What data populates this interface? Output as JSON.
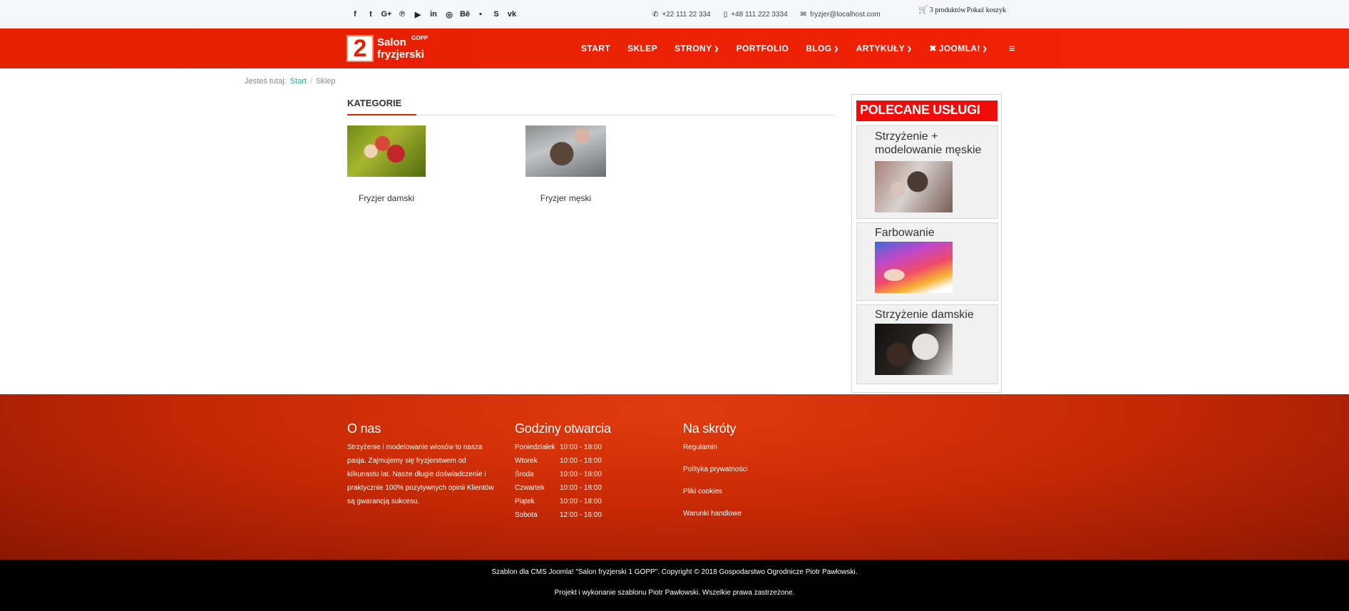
{
  "topbar": {
    "social": [
      {
        "icon": "facebook-icon",
        "glyph": "f"
      },
      {
        "icon": "twitter-icon",
        "glyph": "t"
      },
      {
        "icon": "google-plus-icon",
        "glyph": "G+"
      },
      {
        "icon": "pinterest-icon",
        "glyph": "℗"
      },
      {
        "icon": "youtube-icon",
        "glyph": "▶"
      },
      {
        "icon": "linkedin-icon",
        "glyph": "in"
      },
      {
        "icon": "dribbble-icon",
        "glyph": "◎"
      },
      {
        "icon": "behance-icon",
        "glyph": "Bē"
      },
      {
        "icon": "flickr-icon",
        "glyph": "▪"
      },
      {
        "icon": "skype-icon",
        "glyph": "S"
      },
      {
        "icon": "vk-icon",
        "glyph": "vk"
      }
    ],
    "phone1": "+22 111 22 334",
    "phone2": "+48 111 222 3334",
    "email": "fryzjer@localhost.com",
    "cart_count": "3 produktów",
    "cart_show": "Pokaż koszyk"
  },
  "nav": {
    "logo_number": "2",
    "logo_line1": "Salon",
    "logo_line2": "fryzjerski",
    "logo_badge": "GOPP",
    "items": [
      "START",
      "SKLEP",
      "STRONY",
      "PORTFOLIO",
      "BLOG",
      "ARTYKUŁY",
      "JOOMLA!"
    ]
  },
  "breadcrumb": {
    "prefix": "Jesteś tutaj:",
    "start": "Start",
    "current": "Sklep"
  },
  "main": {
    "title": "KATEGORIE",
    "categories": [
      "Fryzjer damski",
      "Fryzjer męski"
    ]
  },
  "sidebar": {
    "title": "POLECANE USŁUGI",
    "items": [
      "Strzyżenie + modelowanie męskie",
      "Farbowanie",
      "Strzyżenie damskie"
    ]
  },
  "footer": {
    "about_title": "O nas",
    "about_text": "Strzyżenie i modelowanie włosów to nasza pasja. Zajmujemy się fryzjerstwem od kilkunastu lat. Nasze długie doświadczenie i praktycznie 100% pozytywnych opinii Klientów są gwarancją sukcesu.",
    "hours_title": "Godziny otwarcia",
    "hours": [
      {
        "day": "Poniedziałek",
        "time": "10:00 - 18:00"
      },
      {
        "day": "Wtorek",
        "time": "10:00 - 18:00"
      },
      {
        "day": "Środa",
        "time": "10:00 - 18:00"
      },
      {
        "day": "Czwartek",
        "time": "10:00 - 18:00"
      },
      {
        "day": "Piątek",
        "time": "10:00 - 18:00"
      },
      {
        "day": "Sobota",
        "time": "12:00 - 16:00"
      }
    ],
    "links_title": "Na skróty",
    "links": [
      "Regulamin",
      "Polityka prywatności",
      "Pliki cookies",
      "Warunki handlowe"
    ],
    "copyright": "Szablon dla CMS Joomla! \"Salon fryzjerski 1 GOPP\". Copyright © 2018 Gospodarstwo Ogrodnicze Piotr Pawłowski.",
    "credits": "Projekt i wykonanie szablonu Piotr Pawłowski. Wszelkie prawa zastrzeżone."
  },
  "colors": {
    "accent": "#e42000",
    "sidebar_header": "#f20b0b",
    "link": "#2aa89a"
  }
}
